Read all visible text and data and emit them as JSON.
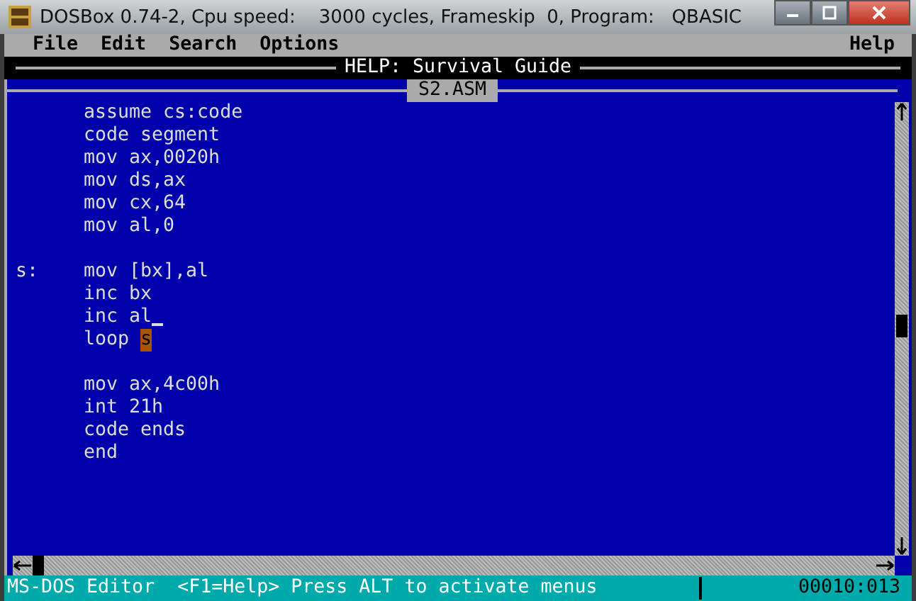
{
  "window": {
    "title": "DOSBox 0.74-2, Cpu speed:    3000 cycles, Frameskip  0, Program:   QBASIC"
  },
  "menu": {
    "items": [
      {
        "label": "File"
      },
      {
        "label": "Edit"
      },
      {
        "label": "Search"
      },
      {
        "label": "Options"
      }
    ],
    "help": "Help"
  },
  "help_window": {
    "title": "HELP: Survival Guide"
  },
  "editor": {
    "filename": "S2.ASM",
    "blocks": [
      [
        {
          "code": "assume cs:code"
        },
        {
          "code": "code segment"
        },
        {
          "code": "mov ax,0020h"
        },
        {
          "code": "mov ds,ax"
        },
        {
          "code": "mov cx,64"
        },
        {
          "code": "mov al,0"
        }
      ],
      [
        {
          "label": "s:",
          "code": "mov [bx],al"
        },
        {
          "code": "inc bx"
        },
        {
          "code": "inc al",
          "cursor": true
        },
        {
          "code": "loop ",
          "selection": "s"
        }
      ],
      [
        {
          "code": "mov ax,4c00h"
        },
        {
          "code": "int 21h"
        },
        {
          "code": "code ends"
        },
        {
          "code": "end"
        }
      ]
    ]
  },
  "status_bar": {
    "message": "MS-DOS Editor  <F1=Help> Press ALT to activate menus",
    "position": "00010:013"
  }
}
